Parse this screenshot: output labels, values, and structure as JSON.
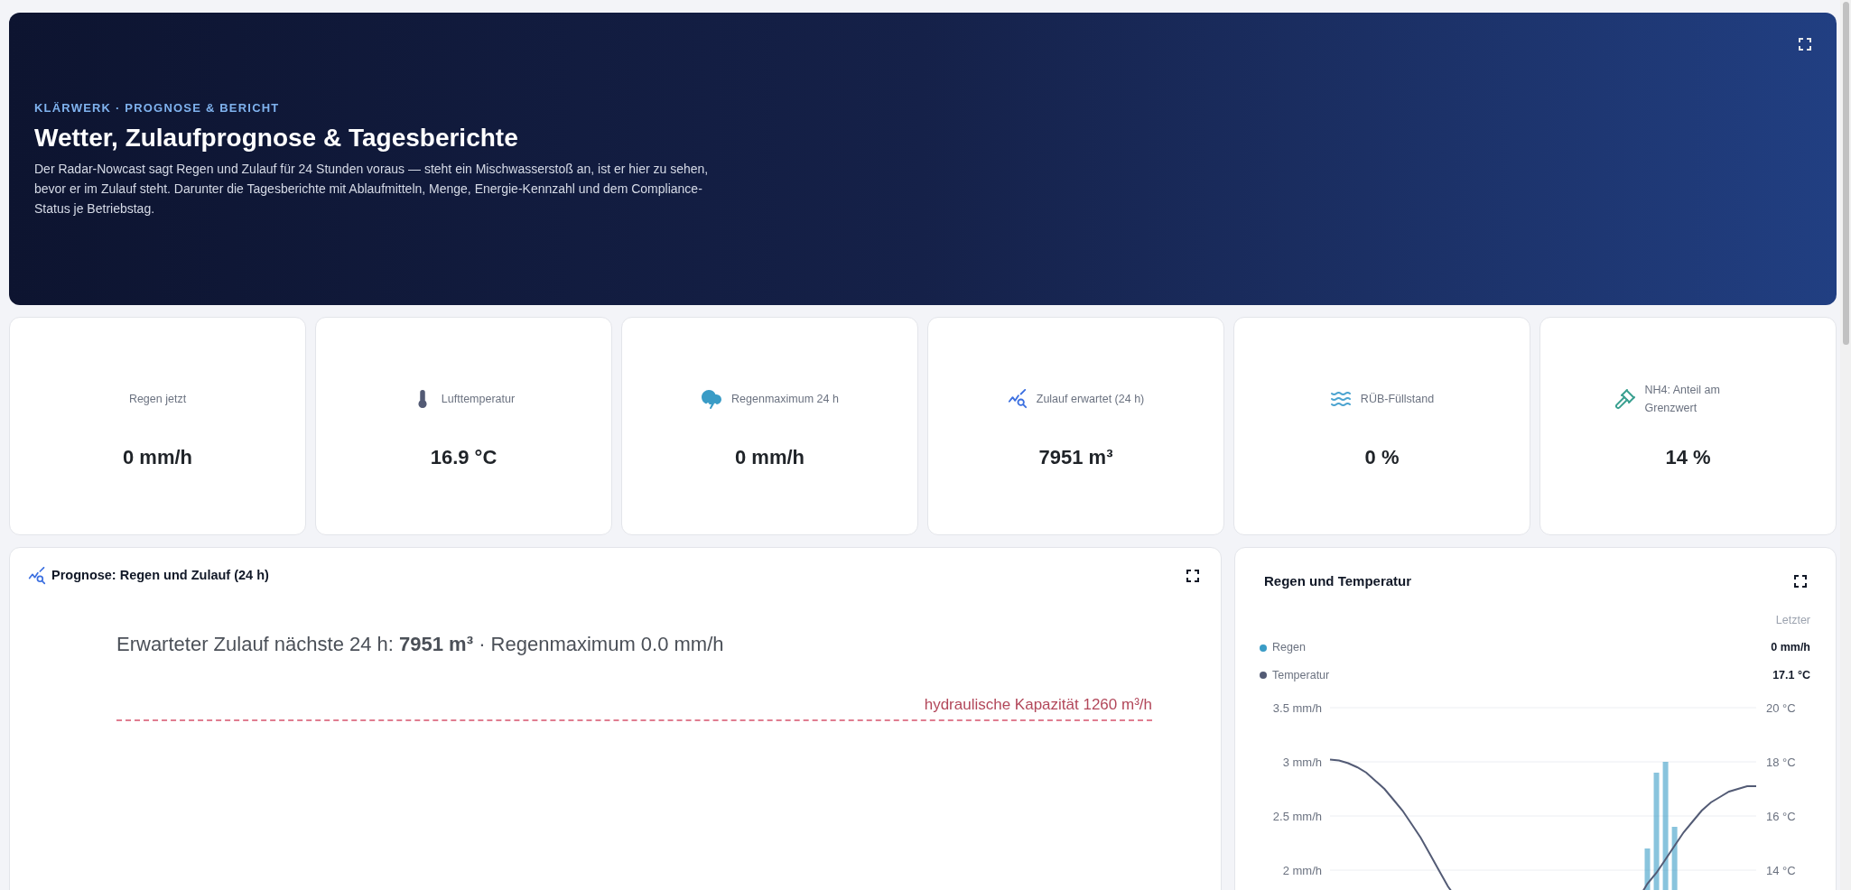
{
  "header": {
    "eyebrow": "KLÄRWERK · PROGNOSE & BERICHT",
    "title": "Wetter, Zulaufprognose & Tagesberichte",
    "description": "Der Radar-Nowcast sagt Regen und Zulauf für 24 Stunden voraus — steht ein Mischwasserstoß an, ist er hier zu sehen, bevor er im Zulauf steht. Darunter die Tagesberichte mit Ablaufmitteln, Menge, Energie-Kennzahl und dem Compliance-Status je Betriebstag."
  },
  "stats": [
    {
      "kind": "plain",
      "label": "Regen jetzt",
      "value": "0 mm/h"
    },
    {
      "kind": "temperature",
      "label": "Lufttemperatur",
      "value": "16.9 °C"
    },
    {
      "kind": "storm",
      "label": "Regenmaximum 24 h",
      "value": "0 mm/h"
    },
    {
      "kind": "inflow",
      "label": "Zulauf erwartet (24 h)",
      "value": "7951 m³"
    },
    {
      "kind": "basin",
      "label": "RÜB-Füllstand",
      "value": "0 %"
    },
    {
      "kind": "compliance",
      "label": "NH4: Anteil am Grenzwert",
      "value": "14 %"
    }
  ],
  "forecast": {
    "title": "Prognose: Regen und Zulauf (24 h)",
    "summary": "Erwarteter Zulauf nächste 24 h: **7951 m³** · Regenmaximum 0.0 mm/h",
    "capacity_label": "hydraulische Kapazität 1260 m³/h"
  },
  "weather": {
    "title": "Regen und Temperatur",
    "legend_header": "Letzter",
    "legend": [
      {
        "reading": "0 mm/h"
      },
      {
        "reading": "17.1 °C"
      }
    ],
    "chart_data": {
      "type": "line",
      "grid": true,
      "ylim": [
        1.8,
        3.5
      ],
      "y2lim": [
        13.2,
        20
      ],
      "yticks": [
        {
          "value": 2,
          "label": "2 mm/h"
        },
        {
          "value": 2.5,
          "label": "2.5 mm/h"
        },
        {
          "value": 3,
          "label": "3 mm/h"
        },
        {
          "value": 3.5,
          "label": "3.5 mm/h"
        }
      ],
      "y2ticks": [
        {
          "value": 14,
          "label": "14 °C"
        },
        {
          "value": 16,
          "label": "16 °C"
        },
        {
          "value": 18,
          "label": "18 °C"
        },
        {
          "value": 20,
          "label": "20 °C"
        }
      ],
      "series": [
        {
          "name": "Regen",
          "type": "bar",
          "axis": "y",
          "color": "#3a9cc6",
          "values": [
            null,
            null,
            null,
            null,
            null,
            null,
            null,
            null,
            null,
            null,
            null,
            null,
            null,
            null,
            null,
            null,
            null,
            null,
            null,
            null,
            null,
            null,
            null,
            null,
            null,
            null,
            null,
            null,
            null,
            null,
            null,
            null,
            null,
            null,
            null,
            2.2,
            2.9,
            3.0,
            2.4,
            null,
            null,
            null,
            null,
            null,
            null,
            null,
            null,
            null
          ]
        },
        {
          "name": "Temperatur",
          "type": "line",
          "axis": "y2",
          "color": "#535b75",
          "values": [
            18.08,
            18.05,
            17.95,
            17.8,
            17.6,
            17.3,
            17.0,
            16.6,
            16.2,
            15.7,
            15.2,
            14.6,
            14.0,
            13.4,
            null,
            null,
            null,
            null,
            null,
            null,
            null,
            null,
            null,
            null,
            null,
            null,
            null,
            null,
            null,
            null,
            null,
            null,
            null,
            null,
            null,
            13.5,
            13.9,
            14.4,
            14.9,
            15.4,
            15.8,
            16.2,
            16.5,
            16.7,
            16.9,
            17.0,
            17.1,
            17.1
          ]
        }
      ]
    }
  }
}
